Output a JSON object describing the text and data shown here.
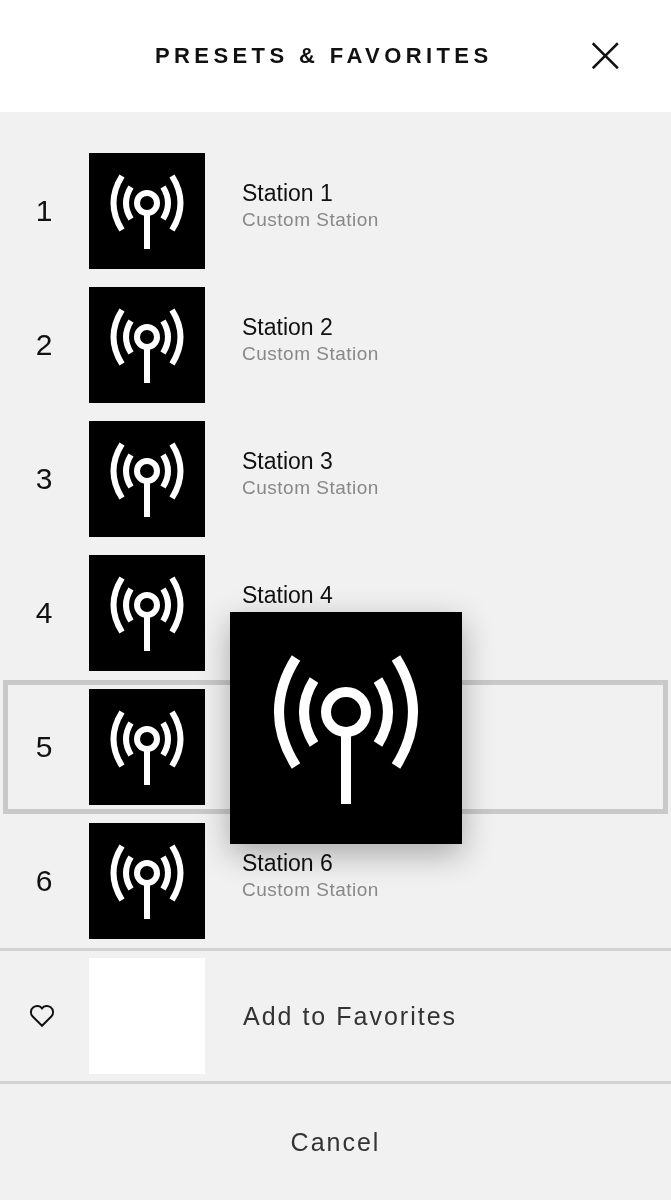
{
  "header": {
    "title": "PRESETS & FAVORITES",
    "close": "×"
  },
  "presets": [
    {
      "number": "1",
      "title": "Station 1",
      "subtitle": "Custom Station",
      "selected": false
    },
    {
      "number": "2",
      "title": "Station 2",
      "subtitle": "Custom Station",
      "selected": false
    },
    {
      "number": "3",
      "title": "Station 3",
      "subtitle": "Custom Station",
      "selected": false
    },
    {
      "number": "4",
      "title": "Station 4",
      "selected": false
    },
    {
      "number": "5",
      "selected": true
    },
    {
      "number": "6",
      "title": "Station 6",
      "subtitle": "Custom Station",
      "selected": false
    }
  ],
  "add_favorite": {
    "label": "Add to Favorites"
  },
  "cancel": "Cancel"
}
